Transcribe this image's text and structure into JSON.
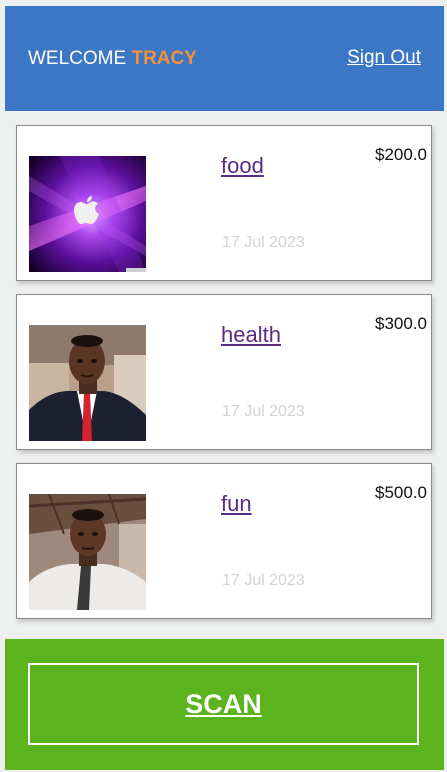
{
  "header": {
    "welcome_text": "WELCOME",
    "user_name": "TRACY",
    "sign_out_label": "Sign Out"
  },
  "transactions": [
    {
      "category": "food",
      "amount": "$200.0",
      "date": "17 Jul 2023",
      "image": "apple-logo-wallpaper"
    },
    {
      "category": "health",
      "amount": "$300.0",
      "date": "17 Jul 2023",
      "image": "man-selfie-suit-red-tie"
    },
    {
      "category": "fun",
      "amount": "$500.0",
      "date": "17 Jul 2023",
      "image": "man-selfie-white-shirt"
    }
  ],
  "footer": {
    "scan_label": "SCAN"
  },
  "colors": {
    "header_bg": "#3b77c5",
    "accent_name": "#f5903a",
    "link": "#5a2b84",
    "footer_bg": "#5bb31d",
    "date_text": "#d3d3d3"
  }
}
